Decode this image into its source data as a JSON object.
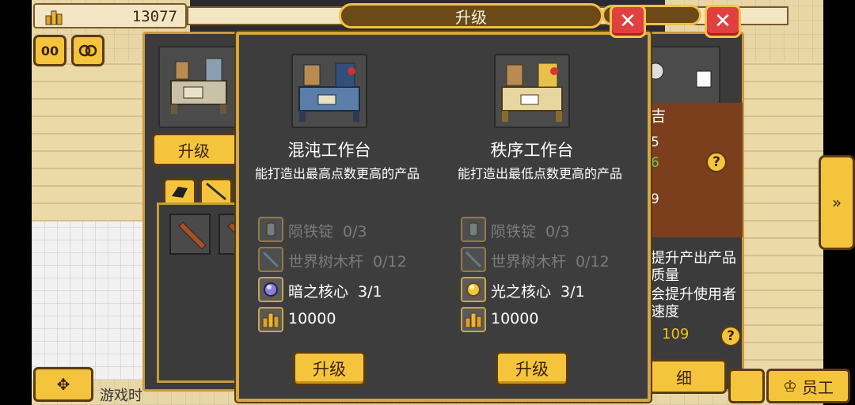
{
  "top_bar": {
    "gold_value": "13077",
    "pause_label": "00"
  },
  "back_panel": {
    "upgrade_label": "升级",
    "right_partial": {
      "name_char": "吉",
      "stat1": "5",
      "stat2": "6",
      "stat3": "9",
      "desc_line1": "提升产出产品",
      "desc_line2": "质量",
      "desc_line3": "会提升使用者",
      "desc_line4": "速度",
      "value": "109",
      "detail_label": "细"
    }
  },
  "dialog": {
    "title": "升级",
    "close_symbol": "✕",
    "benches": [
      {
        "name": "混沌工作台",
        "desc": "能打造出最高点数更高的产品",
        "requirements": [
          {
            "icon": "meteor-iron-ingot-icon",
            "label": "陨铁锭",
            "amount": "0/3",
            "state": "dim"
          },
          {
            "icon": "world-tree-pole-icon",
            "label": "世界树木杆",
            "amount": "0/12",
            "state": "dim"
          },
          {
            "icon": "dark-core-icon",
            "label": "暗之核心",
            "amount": "3/1",
            "state": "on"
          },
          {
            "icon": "gold-icon",
            "label": "10000",
            "amount": "",
            "state": "on"
          }
        ],
        "button": "升级"
      },
      {
        "name": "秩序工作台",
        "desc": "能打造出最低点数更高的产品",
        "requirements": [
          {
            "icon": "meteor-iron-ingot-icon",
            "label": "陨铁锭",
            "amount": "0/3",
            "state": "dim"
          },
          {
            "icon": "world-tree-pole-icon",
            "label": "世界树木杆",
            "amount": "0/12",
            "state": "dim"
          },
          {
            "icon": "light-core-icon",
            "label": "光之核心",
            "amount": "3/1",
            "state": "on"
          },
          {
            "icon": "gold-icon",
            "label": "10000",
            "amount": "",
            "state": "on"
          }
        ],
        "button": "升级"
      }
    ]
  },
  "bottom": {
    "game_text": "游戏时",
    "staff_label": "员工"
  },
  "colors": {
    "accent_gold": "#f4c53c",
    "close_red": "#e04040",
    "panel_dark": "#3d3d3d",
    "dim_text": "#7b7b7b",
    "value_yellow": "#f0c020"
  }
}
